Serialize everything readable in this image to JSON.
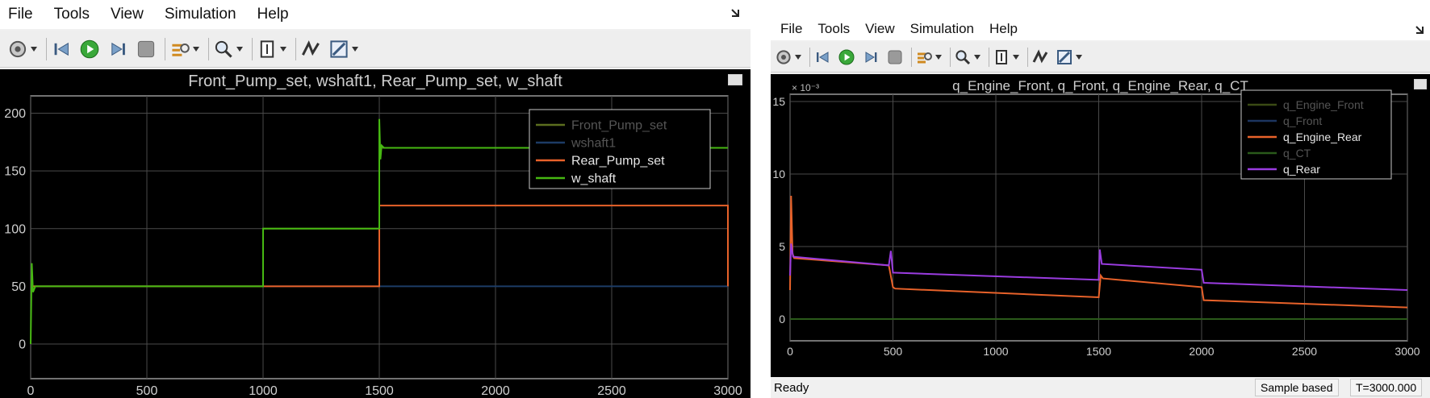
{
  "left_window": {
    "menu": [
      "File",
      "Tools",
      "View",
      "Simulation",
      "Help"
    ],
    "toolbar_icons": [
      "settings-icon",
      "step-back-icon",
      "run-icon",
      "step-forward-icon",
      "stop-icon",
      "highlight-icon",
      "zoom-icon",
      "fit-axes-icon",
      "signal-icon",
      "style-icon"
    ],
    "scope_title": "Front_Pump_set, wshaft1, Rear_Pump_set, w_shaft",
    "chart_data": {
      "type": "line",
      "x_ticks": [
        "0",
        "500",
        "1000",
        "1500",
        "2000",
        "2500",
        "3000"
      ],
      "y_ticks": [
        "0",
        "50",
        "100",
        "150",
        "200"
      ],
      "xlim": [
        0,
        3000
      ],
      "ylim": [
        -30,
        215
      ],
      "grid": true,
      "legend_position": "top-right",
      "series": [
        {
          "name": "Front_Pump_set",
          "color": "#5c6e1e",
          "x": [
            0,
            1000,
            1000,
            1500,
            1500,
            3000
          ],
          "y": [
            50,
            50,
            100,
            100,
            170,
            170
          ]
        },
        {
          "name": "wshaft1",
          "color": "#1d3c66",
          "x": [
            0,
            3000
          ],
          "y": [
            50,
            50
          ]
        },
        {
          "name": "Rear_Pump_set",
          "color": "#e8622a",
          "x": [
            0,
            1500,
            1500,
            3000,
            3000
          ],
          "y": [
            50,
            50,
            120,
            120,
            50
          ]
        },
        {
          "name": "w_shaft",
          "color": "#46b812",
          "x": [
            0,
            5,
            10,
            20,
            1000,
            1000,
            1500,
            1500,
            1505,
            1510,
            1520,
            3000
          ],
          "y": [
            0,
            70,
            45,
            50,
            50,
            100,
            100,
            195,
            160,
            172,
            170,
            170
          ]
        }
      ]
    }
  },
  "right_window": {
    "menu": [
      "File",
      "Tools",
      "View",
      "Simulation",
      "Help"
    ],
    "toolbar_icons": [
      "settings-icon",
      "step-back-icon",
      "run-icon",
      "step-forward-icon",
      "stop-icon",
      "highlight-icon",
      "zoom-icon",
      "fit-axes-icon",
      "signal-icon",
      "style-icon"
    ],
    "scope_title": "q_Engine_Front, q_Front, q_Engine_Rear, q_CT",
    "chart_data": {
      "type": "line",
      "x_ticks": [
        "0",
        "500",
        "1000",
        "1500",
        "2000",
        "2500",
        "3000"
      ],
      "y_ticks": [
        "0",
        "5",
        "10",
        "15"
      ],
      "y_exponent": "× 10⁻³",
      "xlim": [
        0,
        3000
      ],
      "ylim": [
        -1.5,
        15.5
      ],
      "grid": true,
      "legend_position": "top-right",
      "series": [
        {
          "name": "q_Engine_Front",
          "color": "#3a4a14",
          "x": [
            0,
            3000
          ],
          "y": [
            0,
            0
          ]
        },
        {
          "name": "q_Front",
          "color": "#1c3560",
          "x": [
            0,
            3000
          ],
          "y": [
            0,
            0
          ]
        },
        {
          "name": "q_Engine_Rear",
          "color": "#e8622a",
          "x": [
            0,
            5,
            12,
            20,
            480,
            500,
            510,
            1500,
            1510,
            1520,
            2000,
            2010,
            3000
          ],
          "y": [
            2,
            8.5,
            4.5,
            4.2,
            3.7,
            2.2,
            2.1,
            1.5,
            3.0,
            2.8,
            2.2,
            1.3,
            0.8
          ]
        },
        {
          "name": "q_CT",
          "color": "#2a5a1a",
          "x": [
            0,
            3000
          ],
          "y": [
            0,
            0
          ]
        },
        {
          "name": "q_Rear",
          "color": "#9a3ce0",
          "x": [
            0,
            5,
            15,
            480,
            490,
            500,
            1500,
            1505,
            1515,
            2000,
            2010,
            3000
          ],
          "y": [
            3.0,
            5.2,
            4.3,
            3.7,
            4.7,
            3.2,
            2.7,
            4.8,
            3.8,
            3.4,
            2.5,
            2.0
          ]
        }
      ]
    },
    "status": {
      "ready": "Ready",
      "mode": "Sample based",
      "time": "T=3000.000"
    }
  }
}
